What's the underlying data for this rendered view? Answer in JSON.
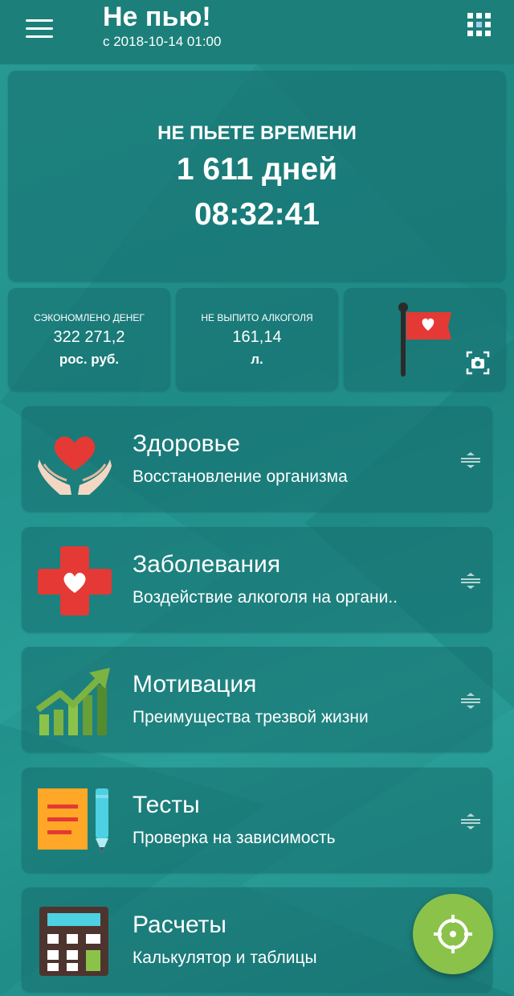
{
  "app": {
    "title": "Не пью!",
    "subtitle": "с 2018-10-14 01:00"
  },
  "timer": {
    "label": "НЕ ПЬЕТЕ ВРЕМЕНИ",
    "days": "1 611 дней",
    "time": "08:32:41"
  },
  "stats": {
    "money": {
      "label": "СЭКОНОМЛЕНО ДЕНЕГ",
      "value": "322 271,2",
      "unit": "рос. руб."
    },
    "alcohol": {
      "label": "НЕ ВЫПИТО АЛКОГОЛЯ",
      "value": "161,14",
      "unit": "л."
    }
  },
  "menu": [
    {
      "title": "Здоровье",
      "subtitle": "Восстановление организма",
      "icon": "health-hands-heart-icon"
    },
    {
      "title": "Заболевания",
      "subtitle": "Воздействие алкоголя на органи..",
      "icon": "medical-cross-icon"
    },
    {
      "title": "Мотивация",
      "subtitle": "Преимущества трезвой жизни",
      "icon": "growth-chart-icon"
    },
    {
      "title": "Тесты",
      "subtitle": "Проверка на зависимость",
      "icon": "test-notepad-icon"
    },
    {
      "title": "Расчеты",
      "subtitle": "Калькулятор и таблицы",
      "icon": "calculator-icon"
    }
  ],
  "colors": {
    "background": "#26958f",
    "appbar": "#1c7f7a",
    "heart": "#e53935",
    "fab": "#8bc34a"
  }
}
